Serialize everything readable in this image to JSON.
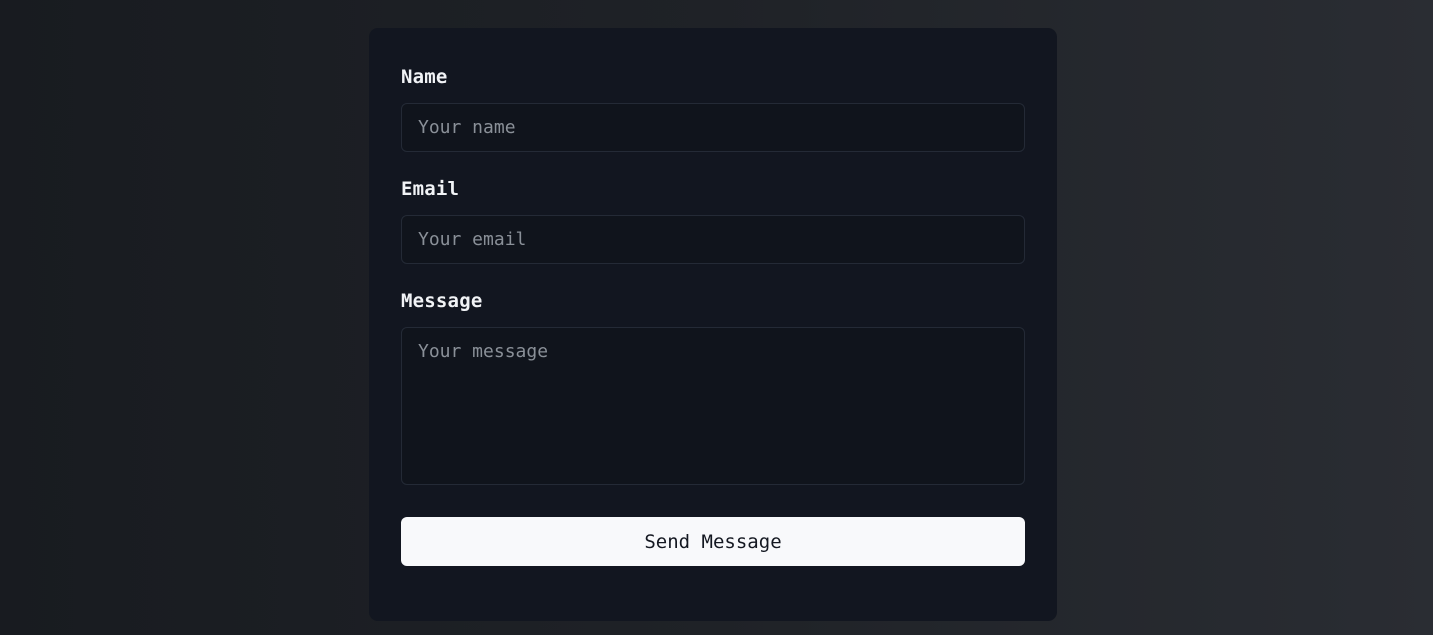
{
  "form": {
    "name": {
      "label": "Name",
      "placeholder": "Your name",
      "value": ""
    },
    "email": {
      "label": "Email",
      "placeholder": "Your email",
      "value": ""
    },
    "message": {
      "label": "Message",
      "placeholder": "Your message",
      "value": ""
    },
    "submit_label": "Send Message"
  },
  "colors": {
    "card_background": "#121620",
    "input_background": "#10141c",
    "input_border": "#242a36",
    "button_background": "#f8f9fb",
    "button_text": "#141821",
    "label_text": "#f1f3f6",
    "placeholder_text": "#8a9098"
  }
}
